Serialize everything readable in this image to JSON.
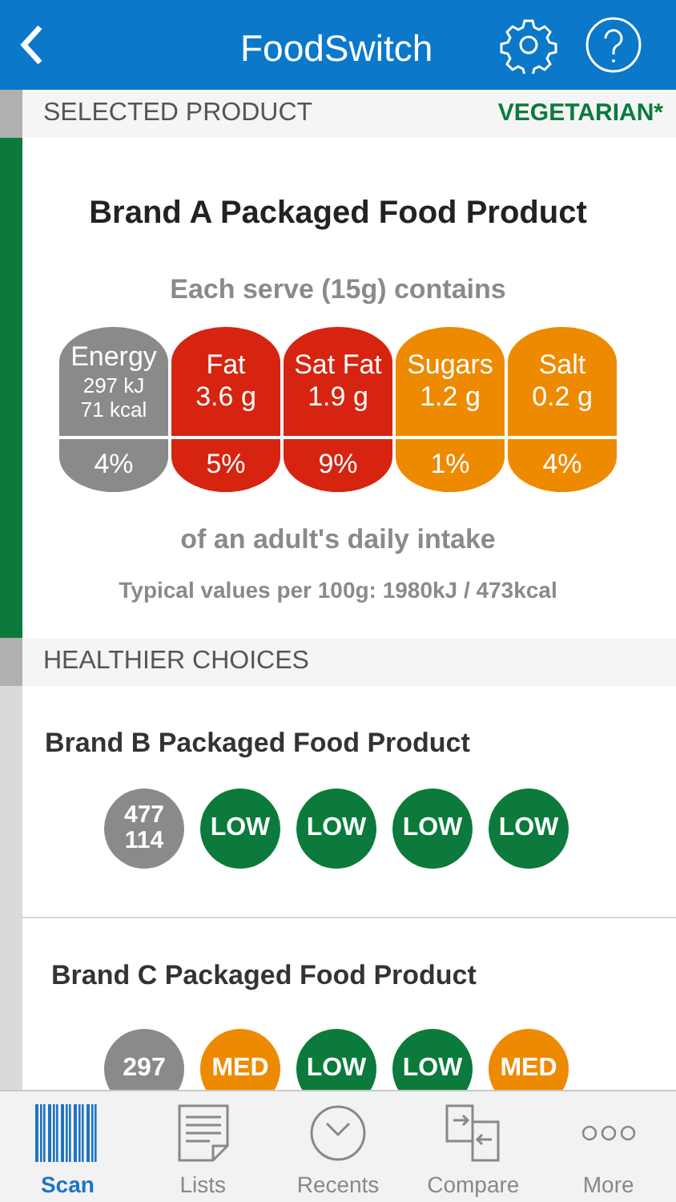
{
  "header": {
    "title": "FoodSwitch"
  },
  "selected_section": {
    "title": "SELECTED PRODUCT",
    "badge": "VEGETARIAN*"
  },
  "product": {
    "name": "Brand A Packaged Food Product",
    "serve": "Each serve (15g) contains",
    "nutrients": [
      {
        "label": "Energy",
        "amounts": [
          "297 kJ",
          "71 kcal"
        ],
        "percent": "4%",
        "color": "#8a8a8a"
      },
      {
        "label": "Fat",
        "amounts": [
          "3.6 g"
        ],
        "percent": "5%",
        "color": "#d62410"
      },
      {
        "label": "Sat Fat",
        "amounts": [
          "1.9 g"
        ],
        "percent": "9%",
        "color": "#d62410"
      },
      {
        "label": "Sugars",
        "amounts": [
          "1.2 g"
        ],
        "percent": "1%",
        "color": "#ee8a00"
      },
      {
        "label": "Salt",
        "amounts": [
          "0.2 g"
        ],
        "percent": "4%",
        "color": "#ee8a00"
      }
    ],
    "intake": "of an adult's daily intake",
    "typical": "Typical values per 100g: 1980kJ / 473kcal"
  },
  "choices_section": {
    "title": "HEALTHIER CHOICES"
  },
  "choices": [
    {
      "name": "Brand B Packaged Food Product",
      "badges": [
        {
          "lines": [
            "477",
            "114"
          ],
          "color": "#8a8a8a"
        },
        {
          "lines": [
            "LOW"
          ],
          "color": "#0b7a3b"
        },
        {
          "lines": [
            "LOW"
          ],
          "color": "#0b7a3b"
        },
        {
          "lines": [
            "LOW"
          ],
          "color": "#0b7a3b"
        },
        {
          "lines": [
            "LOW"
          ],
          "color": "#0b7a3b"
        }
      ]
    },
    {
      "name": "Brand C Packaged Food Product",
      "badges": [
        {
          "lines": [
            "297"
          ],
          "color": "#8a8a8a"
        },
        {
          "lines": [
            "MED"
          ],
          "color": "#ee8a00"
        },
        {
          "lines": [
            "LOW"
          ],
          "color": "#0b7a3b"
        },
        {
          "lines": [
            "LOW"
          ],
          "color": "#0b7a3b"
        },
        {
          "lines": [
            "MED"
          ],
          "color": "#ee8a00"
        }
      ]
    }
  ],
  "tabs": [
    {
      "label": "Scan",
      "kind": "barcode",
      "selected": true
    },
    {
      "label": "Lists",
      "kind": "list",
      "selected": false
    },
    {
      "label": "Recents",
      "kind": "clock",
      "selected": false
    },
    {
      "label": "Compare",
      "kind": "compare",
      "selected": false
    },
    {
      "label": "More",
      "kind": "more",
      "selected": false
    }
  ]
}
